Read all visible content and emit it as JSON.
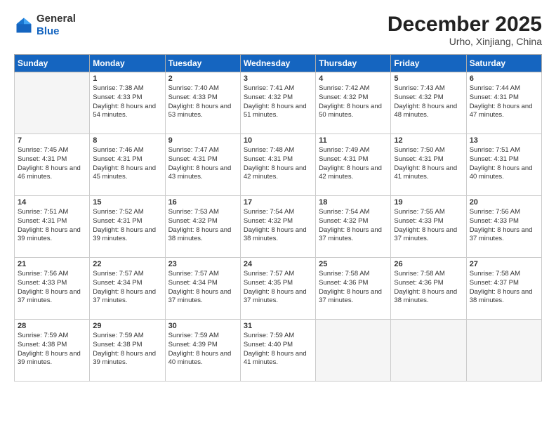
{
  "header": {
    "logo_general": "General",
    "logo_blue": "Blue",
    "month_title": "December 2025",
    "location": "Urho, Xinjiang, China"
  },
  "days_of_week": [
    "Sunday",
    "Monday",
    "Tuesday",
    "Wednesday",
    "Thursday",
    "Friday",
    "Saturday"
  ],
  "weeks": [
    [
      {
        "day": "",
        "empty": true
      },
      {
        "day": "1",
        "sunrise": "7:38 AM",
        "sunset": "4:33 PM",
        "daylight": "8 hours and 54 minutes."
      },
      {
        "day": "2",
        "sunrise": "7:40 AM",
        "sunset": "4:33 PM",
        "daylight": "8 hours and 53 minutes."
      },
      {
        "day": "3",
        "sunrise": "7:41 AM",
        "sunset": "4:32 PM",
        "daylight": "8 hours and 51 minutes."
      },
      {
        "day": "4",
        "sunrise": "7:42 AM",
        "sunset": "4:32 PM",
        "daylight": "8 hours and 50 minutes."
      },
      {
        "day": "5",
        "sunrise": "7:43 AM",
        "sunset": "4:32 PM",
        "daylight": "8 hours and 48 minutes."
      },
      {
        "day": "6",
        "sunrise": "7:44 AM",
        "sunset": "4:31 PM",
        "daylight": "8 hours and 47 minutes."
      }
    ],
    [
      {
        "day": "7",
        "sunrise": "7:45 AM",
        "sunset": "4:31 PM",
        "daylight": "8 hours and 46 minutes."
      },
      {
        "day": "8",
        "sunrise": "7:46 AM",
        "sunset": "4:31 PM",
        "daylight": "8 hours and 45 minutes."
      },
      {
        "day": "9",
        "sunrise": "7:47 AM",
        "sunset": "4:31 PM",
        "daylight": "8 hours and 43 minutes."
      },
      {
        "day": "10",
        "sunrise": "7:48 AM",
        "sunset": "4:31 PM",
        "daylight": "8 hours and 42 minutes."
      },
      {
        "day": "11",
        "sunrise": "7:49 AM",
        "sunset": "4:31 PM",
        "daylight": "8 hours and 42 minutes."
      },
      {
        "day": "12",
        "sunrise": "7:50 AM",
        "sunset": "4:31 PM",
        "daylight": "8 hours and 41 minutes."
      },
      {
        "day": "13",
        "sunrise": "7:51 AM",
        "sunset": "4:31 PM",
        "daylight": "8 hours and 40 minutes."
      }
    ],
    [
      {
        "day": "14",
        "sunrise": "7:51 AM",
        "sunset": "4:31 PM",
        "daylight": "8 hours and 39 minutes."
      },
      {
        "day": "15",
        "sunrise": "7:52 AM",
        "sunset": "4:31 PM",
        "daylight": "8 hours and 39 minutes."
      },
      {
        "day": "16",
        "sunrise": "7:53 AM",
        "sunset": "4:32 PM",
        "daylight": "8 hours and 38 minutes."
      },
      {
        "day": "17",
        "sunrise": "7:54 AM",
        "sunset": "4:32 PM",
        "daylight": "8 hours and 38 minutes."
      },
      {
        "day": "18",
        "sunrise": "7:54 AM",
        "sunset": "4:32 PM",
        "daylight": "8 hours and 37 minutes."
      },
      {
        "day": "19",
        "sunrise": "7:55 AM",
        "sunset": "4:33 PM",
        "daylight": "8 hours and 37 minutes."
      },
      {
        "day": "20",
        "sunrise": "7:56 AM",
        "sunset": "4:33 PM",
        "daylight": "8 hours and 37 minutes."
      }
    ],
    [
      {
        "day": "21",
        "sunrise": "7:56 AM",
        "sunset": "4:33 PM",
        "daylight": "8 hours and 37 minutes."
      },
      {
        "day": "22",
        "sunrise": "7:57 AM",
        "sunset": "4:34 PM",
        "daylight": "8 hours and 37 minutes."
      },
      {
        "day": "23",
        "sunrise": "7:57 AM",
        "sunset": "4:34 PM",
        "daylight": "8 hours and 37 minutes."
      },
      {
        "day": "24",
        "sunrise": "7:57 AM",
        "sunset": "4:35 PM",
        "daylight": "8 hours and 37 minutes."
      },
      {
        "day": "25",
        "sunrise": "7:58 AM",
        "sunset": "4:36 PM",
        "daylight": "8 hours and 37 minutes."
      },
      {
        "day": "26",
        "sunrise": "7:58 AM",
        "sunset": "4:36 PM",
        "daylight": "8 hours and 38 minutes."
      },
      {
        "day": "27",
        "sunrise": "7:58 AM",
        "sunset": "4:37 PM",
        "daylight": "8 hours and 38 minutes."
      }
    ],
    [
      {
        "day": "28",
        "sunrise": "7:59 AM",
        "sunset": "4:38 PM",
        "daylight": "8 hours and 39 minutes."
      },
      {
        "day": "29",
        "sunrise": "7:59 AM",
        "sunset": "4:38 PM",
        "daylight": "8 hours and 39 minutes."
      },
      {
        "day": "30",
        "sunrise": "7:59 AM",
        "sunset": "4:39 PM",
        "daylight": "8 hours and 40 minutes."
      },
      {
        "day": "31",
        "sunrise": "7:59 AM",
        "sunset": "4:40 PM",
        "daylight": "8 hours and 41 minutes."
      },
      {
        "day": "",
        "empty": true
      },
      {
        "day": "",
        "empty": true
      },
      {
        "day": "",
        "empty": true
      }
    ]
  ]
}
